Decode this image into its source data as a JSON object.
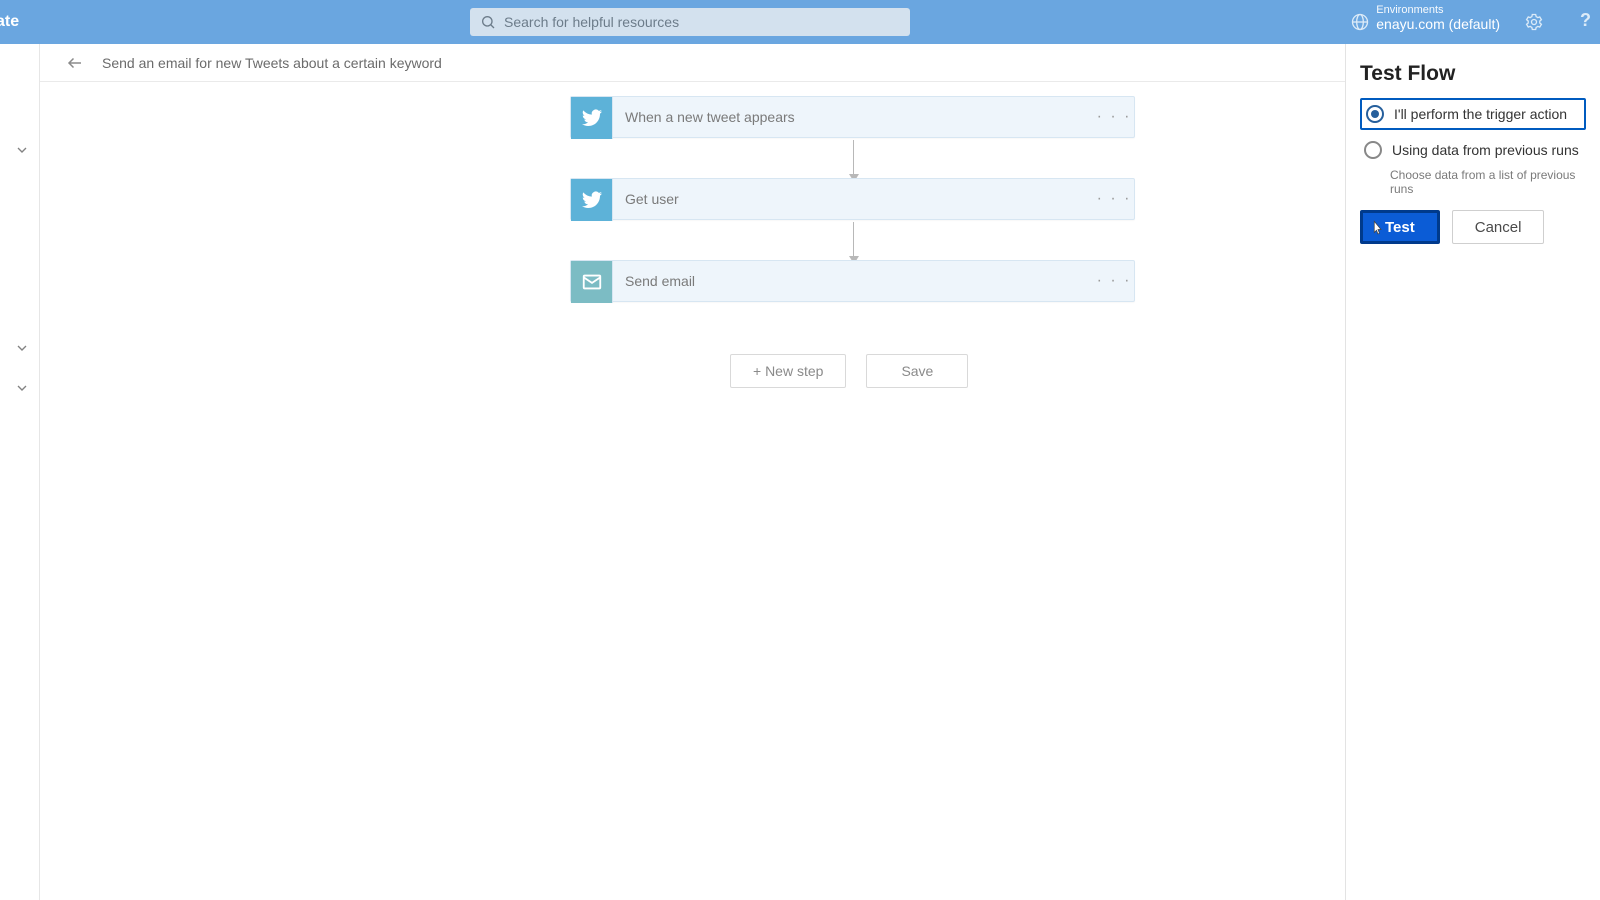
{
  "topbar": {
    "left_fragment": "ate",
    "search_placeholder": "Search for helpful resources",
    "env_label": "Environments",
    "env_value": "enayu.com (default)"
  },
  "subhead": {
    "flow_name": "Send an email for new Tweets about a certain keyword"
  },
  "steps": [
    {
      "label": "When a new tweet appears",
      "kind": "twitter"
    },
    {
      "label": "Get user",
      "kind": "twitter"
    },
    {
      "label": "Send email",
      "kind": "mail"
    }
  ],
  "buttons": {
    "new_step": "+ New step",
    "save": "Save"
  },
  "panel": {
    "title": "Test Flow",
    "opt1": "I'll perform the trigger action",
    "opt2": "Using data from previous runs",
    "opt2_hint": "Choose data from a list of previous runs",
    "test": "Test",
    "cancel": "Cancel"
  }
}
